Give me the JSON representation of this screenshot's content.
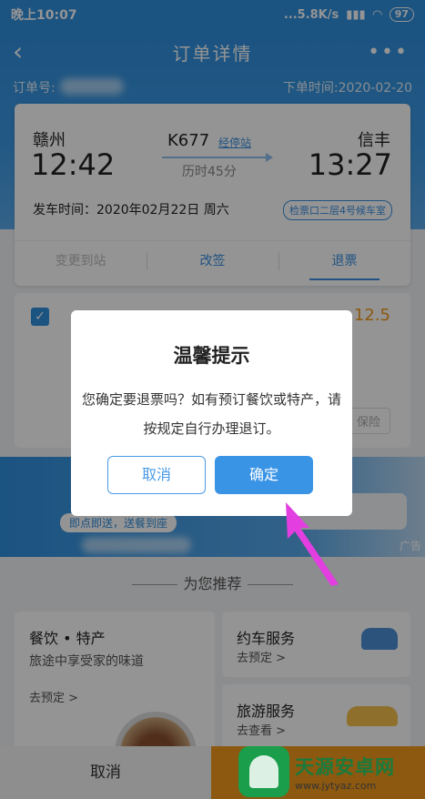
{
  "status_bar": {
    "time": "晚上10:07",
    "network": "...5.8K/s",
    "battery": "97"
  },
  "nav": {
    "title": "订单详情",
    "back_icon": "chevron-left-icon",
    "more_icon": "more-dots-icon"
  },
  "order": {
    "number_label": "订单号:",
    "order_time": "下单时间:2020-02-20"
  },
  "ticket": {
    "from_station": "赣州",
    "to_station": "信丰",
    "depart_time": "12:42",
    "arrive_time": "13:27",
    "train_no": "K677",
    "stops_link": "经停站",
    "duration": "历时45分",
    "depart_date": "发车时间：2020年02月22日 周六",
    "gate": "检票口二层4号候车室",
    "tabs": [
      {
        "label": "变更到站"
      },
      {
        "label": "改签"
      },
      {
        "label": "退票"
      }
    ]
  },
  "passenger": {
    "price": "12.5",
    "insurance": "保险"
  },
  "banner": {
    "slogan": "即点即送，送餐到座",
    "ad_label": "广告"
  },
  "recommend": {
    "title": "为您推荐",
    "food": {
      "title": "餐饮 • 特产",
      "subtitle": "旅途中享受家的味道",
      "link": "去预定 >"
    },
    "car": {
      "title": "约车服务",
      "link": "去预定 >"
    },
    "tour": {
      "title": "旅游服务",
      "link": "去查看 >"
    }
  },
  "bottom_bar": {
    "cancel": "取消"
  },
  "dialog": {
    "title": "温馨提示",
    "message": "您确定要退票吗？如有预订餐饮或特产，请按规定自行办理退订。",
    "cancel": "取消",
    "confirm": "确定"
  },
  "watermark": {
    "name": "天源安卓网",
    "url": "www.jytyaz.com"
  },
  "colors": {
    "primary": "#2f8fdf",
    "accent": "#f39a1c",
    "pointer": "#e23ee0"
  }
}
